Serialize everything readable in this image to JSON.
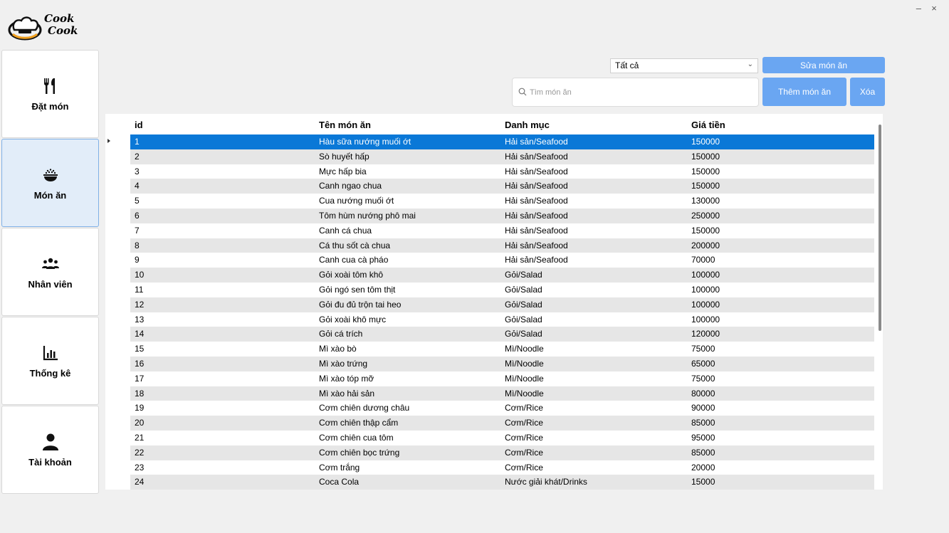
{
  "app": {
    "logo_line1": "Cook",
    "logo_line2": "Cook"
  },
  "nav": [
    {
      "label": "Đặt món",
      "icon": "utensils-icon"
    },
    {
      "label": "Món ăn",
      "icon": "food-bowl-icon",
      "active": true
    },
    {
      "label": "Nhân viên",
      "icon": "users-icon"
    },
    {
      "label": "Thống kê",
      "icon": "bar-chart-icon"
    },
    {
      "label": "Tài khoản",
      "icon": "user-icon"
    }
  ],
  "filter": {
    "selected": "Tất cả"
  },
  "search": {
    "placeholder": "Tìm món ăn"
  },
  "buttons": {
    "edit": "Sửa món ăn",
    "add": "Thêm món ăn",
    "delete": "Xóa"
  },
  "table": {
    "headers": [
      "id",
      "Tên món ăn",
      "Danh mục",
      "Giá tiền"
    ],
    "rows": [
      [
        "1",
        "Hàu sữa nướng muối ớt",
        "Hải sản/Seafood",
        "150000"
      ],
      [
        "2",
        "Sò huyết hấp",
        "Hải sản/Seafood",
        "150000"
      ],
      [
        "3",
        "Mực hấp bia",
        "Hải sản/Seafood",
        "150000"
      ],
      [
        "4",
        "Canh ngao chua",
        "Hải sản/Seafood",
        "150000"
      ],
      [
        "5",
        "Cua nướng muối ớt",
        "Hải sản/Seafood",
        "130000"
      ],
      [
        "6",
        "Tôm hùm nướng phô mai",
        "Hải sản/Seafood",
        "250000"
      ],
      [
        "7",
        "Canh cá chua",
        "Hải sản/Seafood",
        "150000"
      ],
      [
        "8",
        "Cá thu sốt cà chua",
        "Hải sản/Seafood",
        "200000"
      ],
      [
        "9",
        "Canh cua cà pháo",
        "Hải sản/Seafood",
        "70000"
      ],
      [
        "10",
        "Gỏi xoài tôm khô",
        "Gỏi/Salad",
        "100000"
      ],
      [
        "11",
        "Gỏi ngó sen tôm thịt",
        "Gỏi/Salad",
        "100000"
      ],
      [
        "12",
        "Gỏi đu đủ trộn tai heo",
        "Gỏi/Salad",
        "100000"
      ],
      [
        "13",
        "Gỏi xoài khô mực",
        "Gỏi/Salad",
        "100000"
      ],
      [
        "14",
        "Gỏi cá trích",
        "Gỏi/Salad",
        "120000"
      ],
      [
        "15",
        "Mì xào bò",
        "Mì/Noodle",
        "75000"
      ],
      [
        "16",
        "Mì xào trứng",
        "Mì/Noodle",
        "65000"
      ],
      [
        "17",
        "Mì xào tóp mỡ",
        "Mì/Noodle",
        "75000"
      ],
      [
        "18",
        "Mì xào hải sản",
        "Mì/Noodle",
        "80000"
      ],
      [
        "19",
        "Cơm chiên dương châu",
        "Cơm/Rice",
        "90000"
      ],
      [
        "20",
        "Cơm chiên thập cẩm",
        "Cơm/Rice",
        "85000"
      ],
      [
        "21",
        "Cơm chiên cua tôm",
        "Cơm/Rice",
        "95000"
      ],
      [
        "22",
        "Cơm chiên bọc trứng",
        "Cơm/Rice",
        "85000"
      ],
      [
        "23",
        "Cơm trắng",
        "Cơm/Rice",
        "20000"
      ],
      [
        "24",
        "Coca Cola",
        "Nước giải khát/Drinks",
        "15000"
      ]
    ],
    "selected_row": 0
  },
  "colors": {
    "accent": "#6aa6f2",
    "selected": "#0a78d7",
    "active_nav": "#e2edf9"
  }
}
